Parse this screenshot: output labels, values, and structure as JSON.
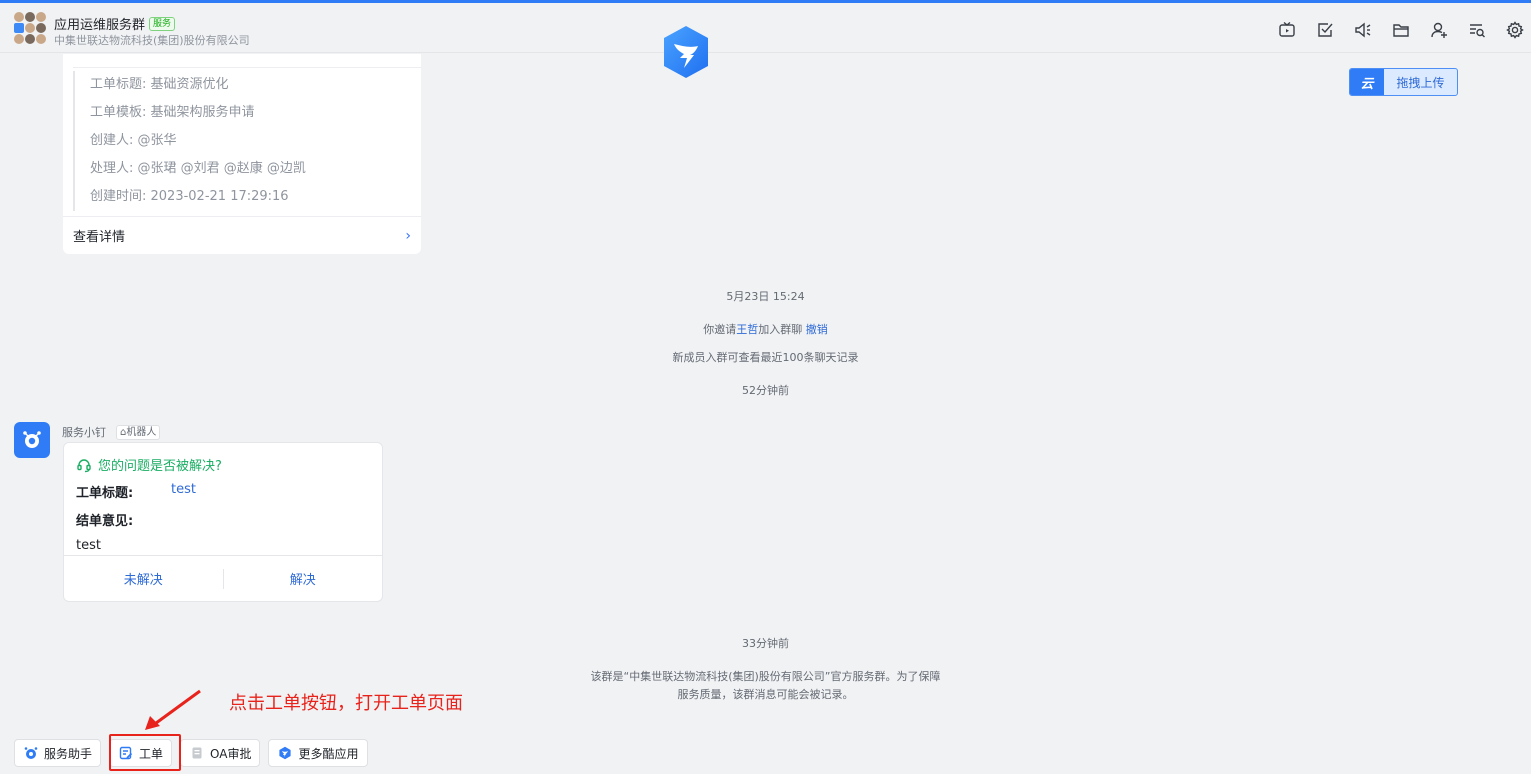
{
  "header": {
    "group_title": "应用运维服务群",
    "badge": "服务",
    "company": "中集世联达物流科技(集团)股份有限公司",
    "icons": [
      "tv-icon",
      "task-check-icon",
      "announcement-icon",
      "folder-icon",
      "add-member-icon",
      "search-history-icon",
      "settings-icon"
    ]
  },
  "upload": {
    "label": "拖拽上传",
    "icon_text": "云"
  },
  "ticket_card": {
    "rows": [
      "工单标题: 基础资源优化",
      "工单模板: 基础架构服务申请",
      "创建人: @张华",
      "处理人: @张珺 @刘君 @赵康 @边凯",
      "创建时间: 2023-02-21 17:29:16"
    ],
    "detail_label": "查看详情",
    "chevron": "›"
  },
  "system": {
    "time1": "5月23日 15:24",
    "invite_prefix": "你邀请",
    "invite_name": "王哲",
    "invite_suffix": "加入群聊",
    "invite_undo": "撤销",
    "history_note": "新成员入群可查看最近100条聊天记录",
    "time2": "52分钟前",
    "time3": "33分钟前",
    "footer_line1": "该群是“中集世联达物流科技(集团)股份有限公司”官方服务群。为了保障",
    "footer_line2": "服务质量，该群消息可能会被记录。"
  },
  "bot": {
    "name": "服务小钉",
    "tag": "机器人",
    "question": "您的问题是否被解决?",
    "title_label": "工单标题:",
    "title_value": "test",
    "opinion_label": "结单意见:",
    "opinion_value": "test",
    "unresolved": "未解决",
    "resolved": "解决"
  },
  "annotation": "点击工单按钮，打开工单页面",
  "bottom_bar": {
    "assistant": "服务助手",
    "ticket": "工单",
    "oa": "OA审批",
    "more": "更多酷应用"
  },
  "colors": {
    "accent": "#2f7cf6",
    "annotation": "#e8231b",
    "success": "#1aad64"
  }
}
